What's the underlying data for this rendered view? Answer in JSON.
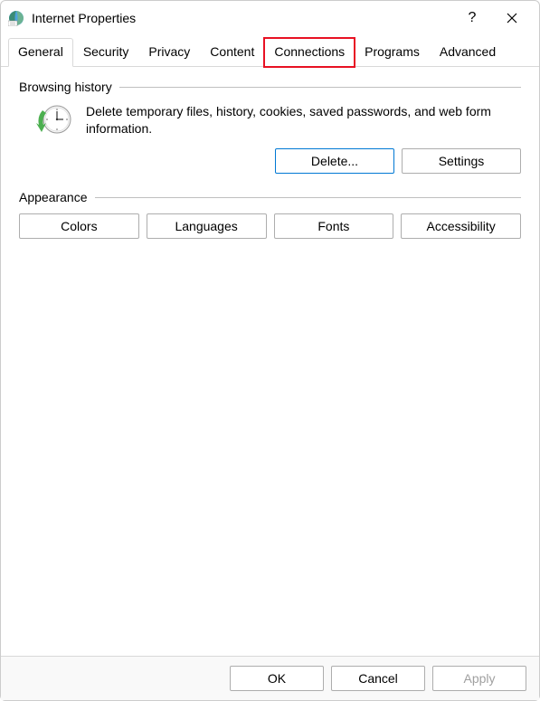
{
  "window": {
    "title": "Internet Properties"
  },
  "tabs": {
    "general": "General",
    "security": "Security",
    "privacy": "Privacy",
    "content": "Content",
    "connections": "Connections",
    "programs": "Programs",
    "advanced": "Advanced"
  },
  "browsing": {
    "group_label": "Browsing history",
    "description": "Delete temporary files, history, cookies, saved passwords, and web form information.",
    "delete_label": "Delete...",
    "settings_label": "Settings"
  },
  "appearance": {
    "group_label": "Appearance",
    "colors_label": "Colors",
    "languages_label": "Languages",
    "fonts_label": "Fonts",
    "accessibility_label": "Accessibility"
  },
  "footer": {
    "ok_label": "OK",
    "cancel_label": "Cancel",
    "apply_label": "Apply"
  }
}
